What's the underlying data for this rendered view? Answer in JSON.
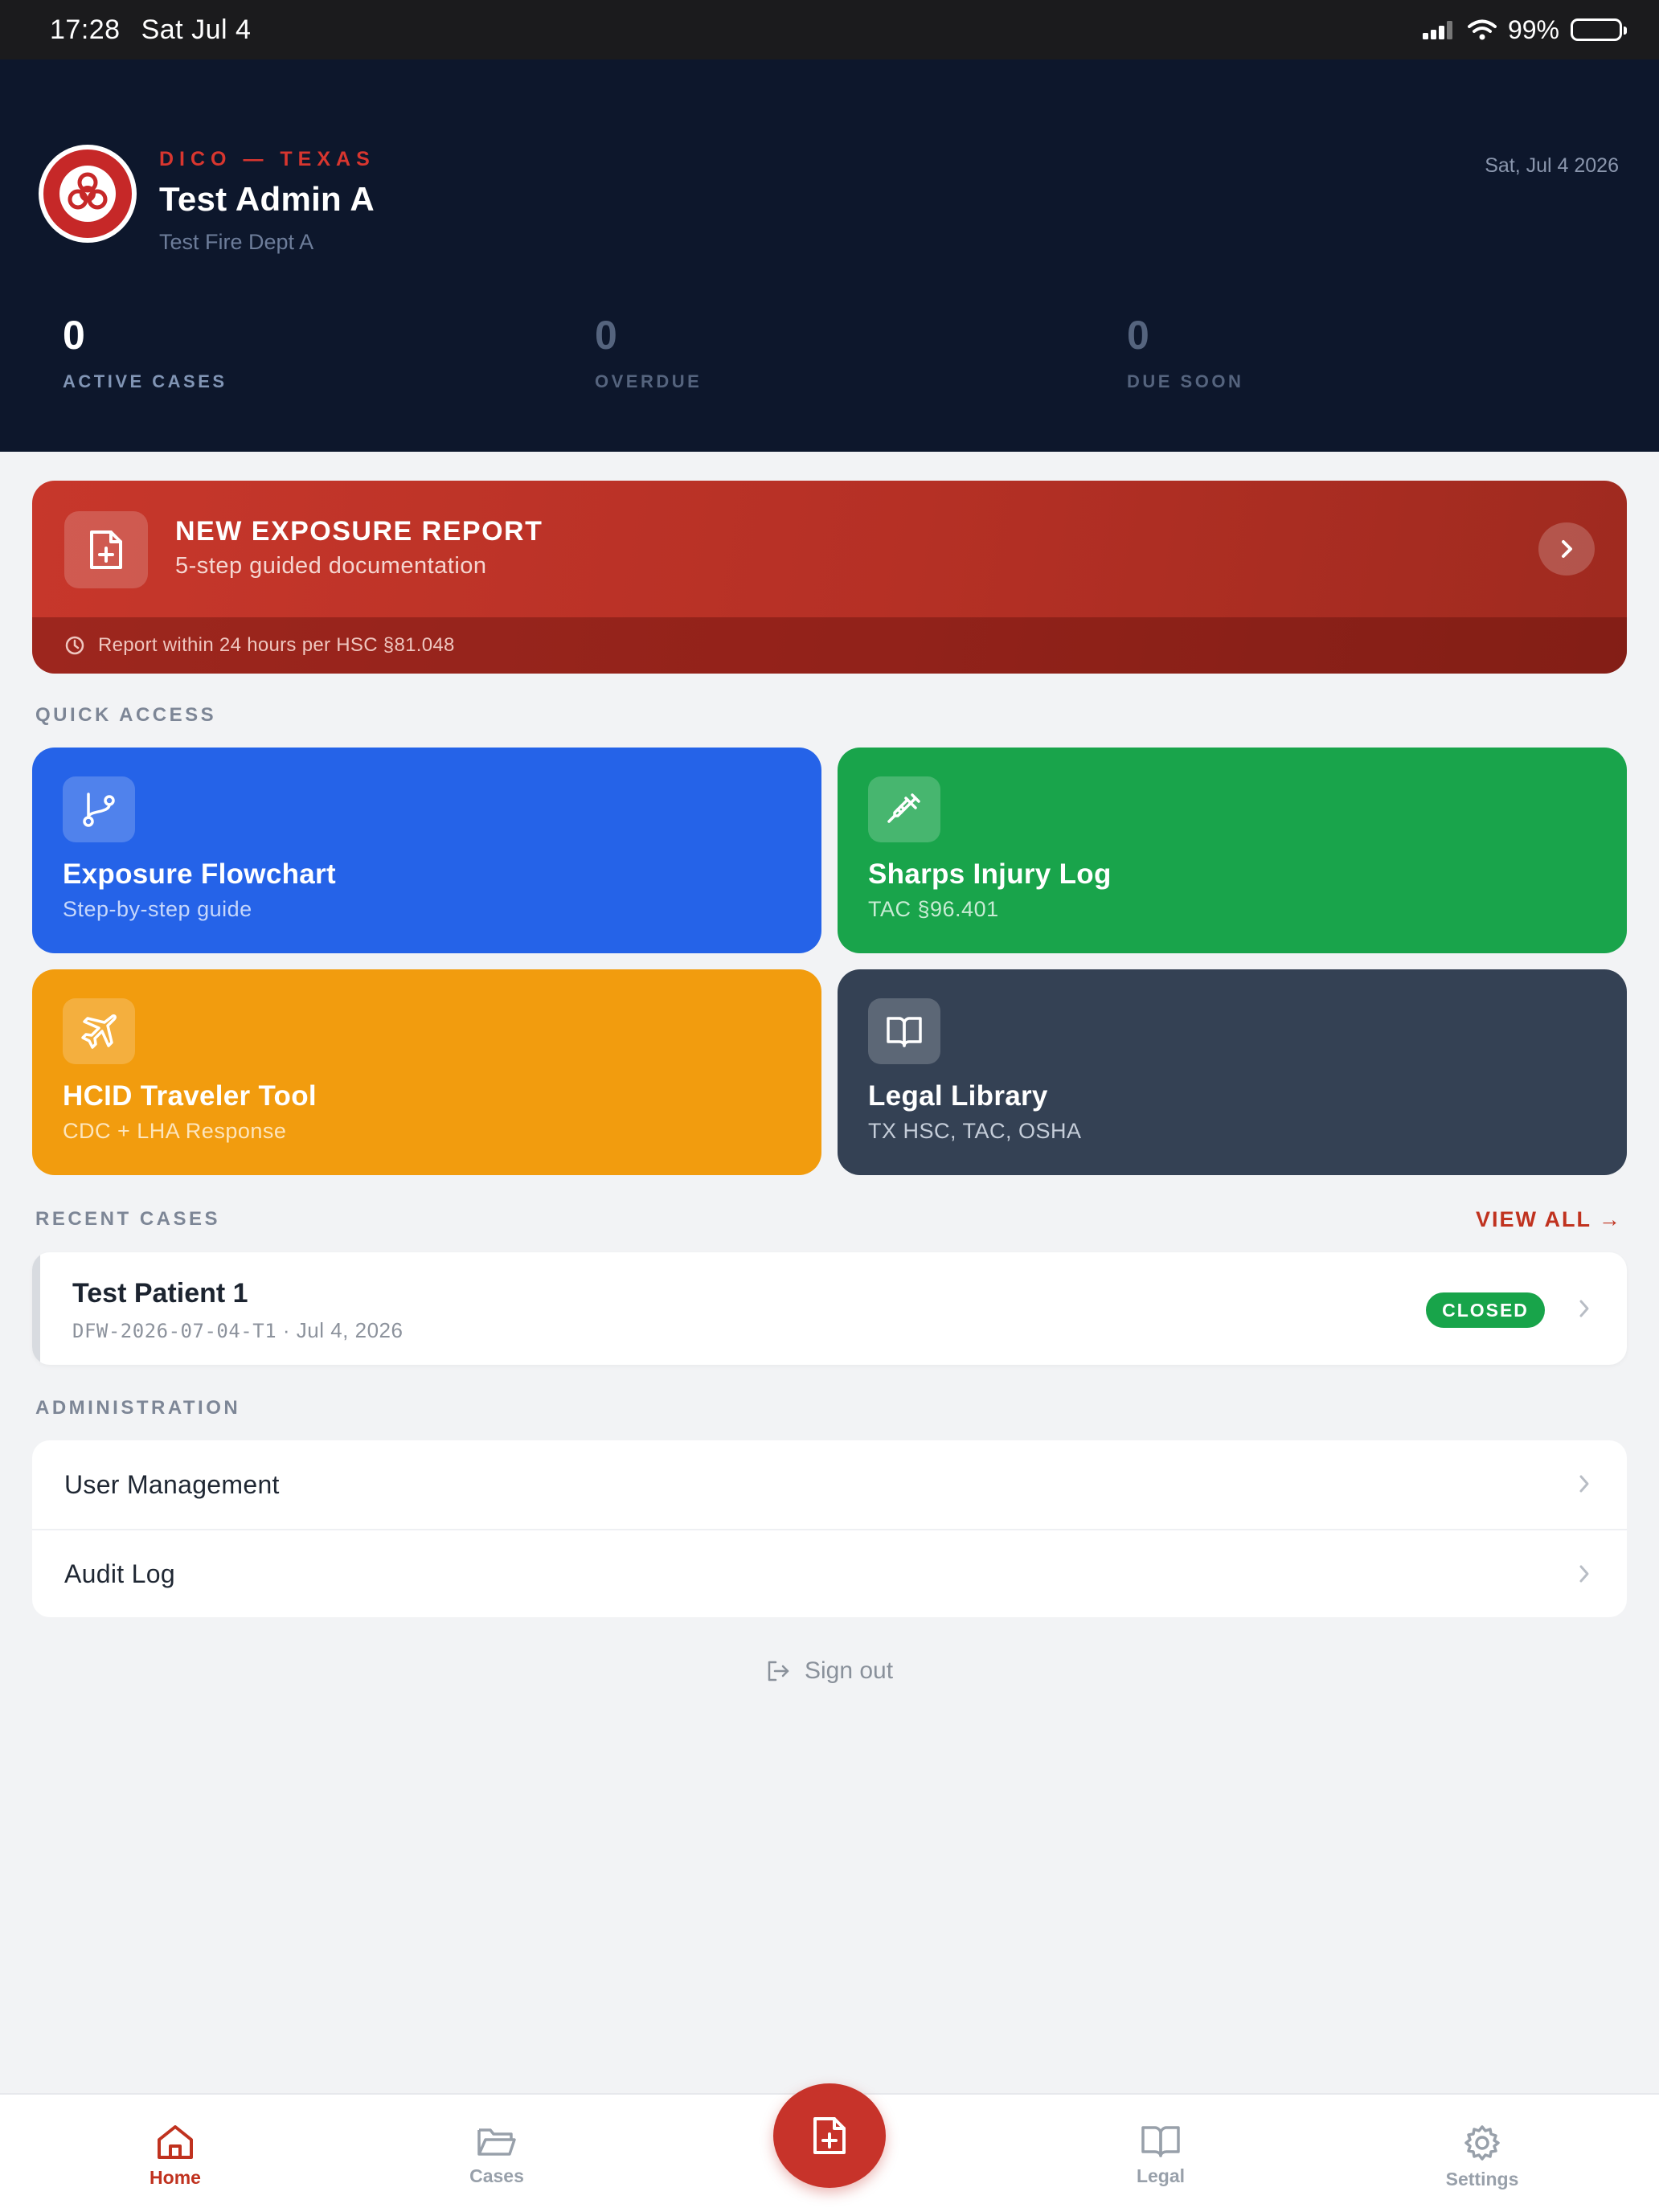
{
  "status_bar": {
    "time": "17:28",
    "day": "Sat Jul 4",
    "battery": "99%"
  },
  "header": {
    "org": "DICO — TEXAS",
    "user_name": "Test Admin A",
    "department": "Test Fire Dept A",
    "date": "Sat, Jul 4 2026",
    "logo_icon": "biohazard-seal-icon",
    "stats": [
      {
        "value": "0",
        "label": "ACTIVE CASES"
      },
      {
        "value": "0",
        "label": "OVERDUE"
      },
      {
        "value": "0",
        "label": "DUE SOON"
      }
    ]
  },
  "new_report": {
    "title": "NEW EXPOSURE REPORT",
    "subtitle": "5-step guided documentation",
    "notice": "Report within 24 hours per HSC §81.048"
  },
  "quick_access": {
    "label": "QUICK ACCESS",
    "tiles": [
      {
        "title": "Exposure Flowchart",
        "subtitle": "Step-by-step guide",
        "icon": "git-branch-icon",
        "color": "#2563e8"
      },
      {
        "title": "Sharps Injury Log",
        "subtitle": "TAC §96.401",
        "icon": "syringe-icon",
        "color": "#19a44b"
      },
      {
        "title": "HCID Traveler Tool",
        "subtitle": "CDC + LHA Response",
        "icon": "plane-icon",
        "color": "#f29c0e"
      },
      {
        "title": "Legal Library",
        "subtitle": "TX HSC, TAC, OSHA",
        "icon": "book-icon",
        "color": "#344154"
      }
    ]
  },
  "recent_cases": {
    "label": "RECENT CASES",
    "view_all": "VIEW ALL →",
    "items": [
      {
        "name": "Test Patient 1",
        "case_id": "DFW-2026-07-04-T1",
        "date": " · Jul 4, 2026",
        "status": "CLOSED"
      }
    ]
  },
  "administration": {
    "label": "ADMINISTRATION",
    "items": [
      {
        "label": "User Management"
      },
      {
        "label": "Audit Log"
      }
    ]
  },
  "sign_out": "Sign out",
  "tab_bar": {
    "tabs": [
      {
        "label": "Home",
        "icon": "home-icon"
      },
      {
        "label": "Cases",
        "icon": "folder-icon"
      },
      {
        "label": "Legal",
        "icon": "book-icon"
      },
      {
        "label": "Settings",
        "icon": "gear-icon"
      }
    ],
    "accent": "#c0321f"
  }
}
